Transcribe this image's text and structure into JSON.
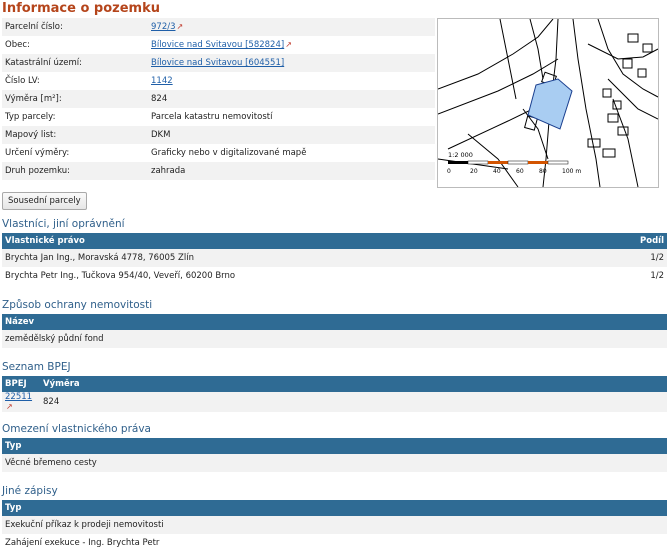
{
  "title": "Informace o pozemku",
  "info": [
    {
      "key": "Parcelní číslo:",
      "value": "972/3",
      "link": true,
      "ext": true
    },
    {
      "key": "Obec:",
      "value": "Bílovice nad Svitavou [582824]",
      "link": true,
      "ext": true
    },
    {
      "key": "Katastrální území:",
      "value": "Bílovice nad Svitavou [604551]",
      "link": true,
      "ext": false
    },
    {
      "key": "Číslo LV:",
      "value": "1142",
      "link": true,
      "ext": false
    },
    {
      "key": "Výměra [m²]:",
      "value": "824",
      "link": false
    },
    {
      "key": "Typ parcely:",
      "value": "Parcela katastru nemovitostí",
      "link": false
    },
    {
      "key": "Mapový list:",
      "value": "DKM",
      "link": false
    },
    {
      "key": "Určení výměry:",
      "value": "Graficky nebo v digitalizované mapě",
      "link": false
    },
    {
      "key": "Druh pozemku:",
      "value": "zahrada",
      "link": false
    }
  ],
  "map": {
    "scale_label": "1:2 000",
    "ticks": [
      "0",
      "20",
      "40",
      "60",
      "80",
      "100 m"
    ],
    "parcel_color": "#a9cdf2"
  },
  "neighbors_button": "Sousední parcely",
  "owners": {
    "heading": "Vlastníci, jiní oprávnění",
    "col_right": "Vlastnické právo",
    "col_share": "Podíl",
    "rows": [
      {
        "name": "Brychta Jan Ing., Moravská 4778, 76005 Zlín",
        "share": "1/2"
      },
      {
        "name": "Brychta Petr Ing., Tučkova 954/40, Veveří, 60200 Brno",
        "share": "1/2"
      }
    ]
  },
  "protection": {
    "heading": "Způsob ochrany nemovitosti",
    "col_name": "Název",
    "rows": [
      "zemědělský půdní fond"
    ]
  },
  "bpej": {
    "heading": "Seznam BPEJ",
    "col_bpej": "BPEJ",
    "col_area": "Výměra",
    "rows": [
      {
        "code": "22511",
        "area": "824"
      }
    ]
  },
  "restrictions": {
    "heading": "Omezení vlastnického práva",
    "col_type": "Typ",
    "rows": [
      "Věcné břemeno cesty"
    ]
  },
  "other": {
    "heading": "Jiné zápisy",
    "col_type": "Typ",
    "rows": [
      "Exekuční příkaz k prodeji nemovitosti",
      "Zahájení exekuce - Ing. Brychta Petr"
    ]
  }
}
